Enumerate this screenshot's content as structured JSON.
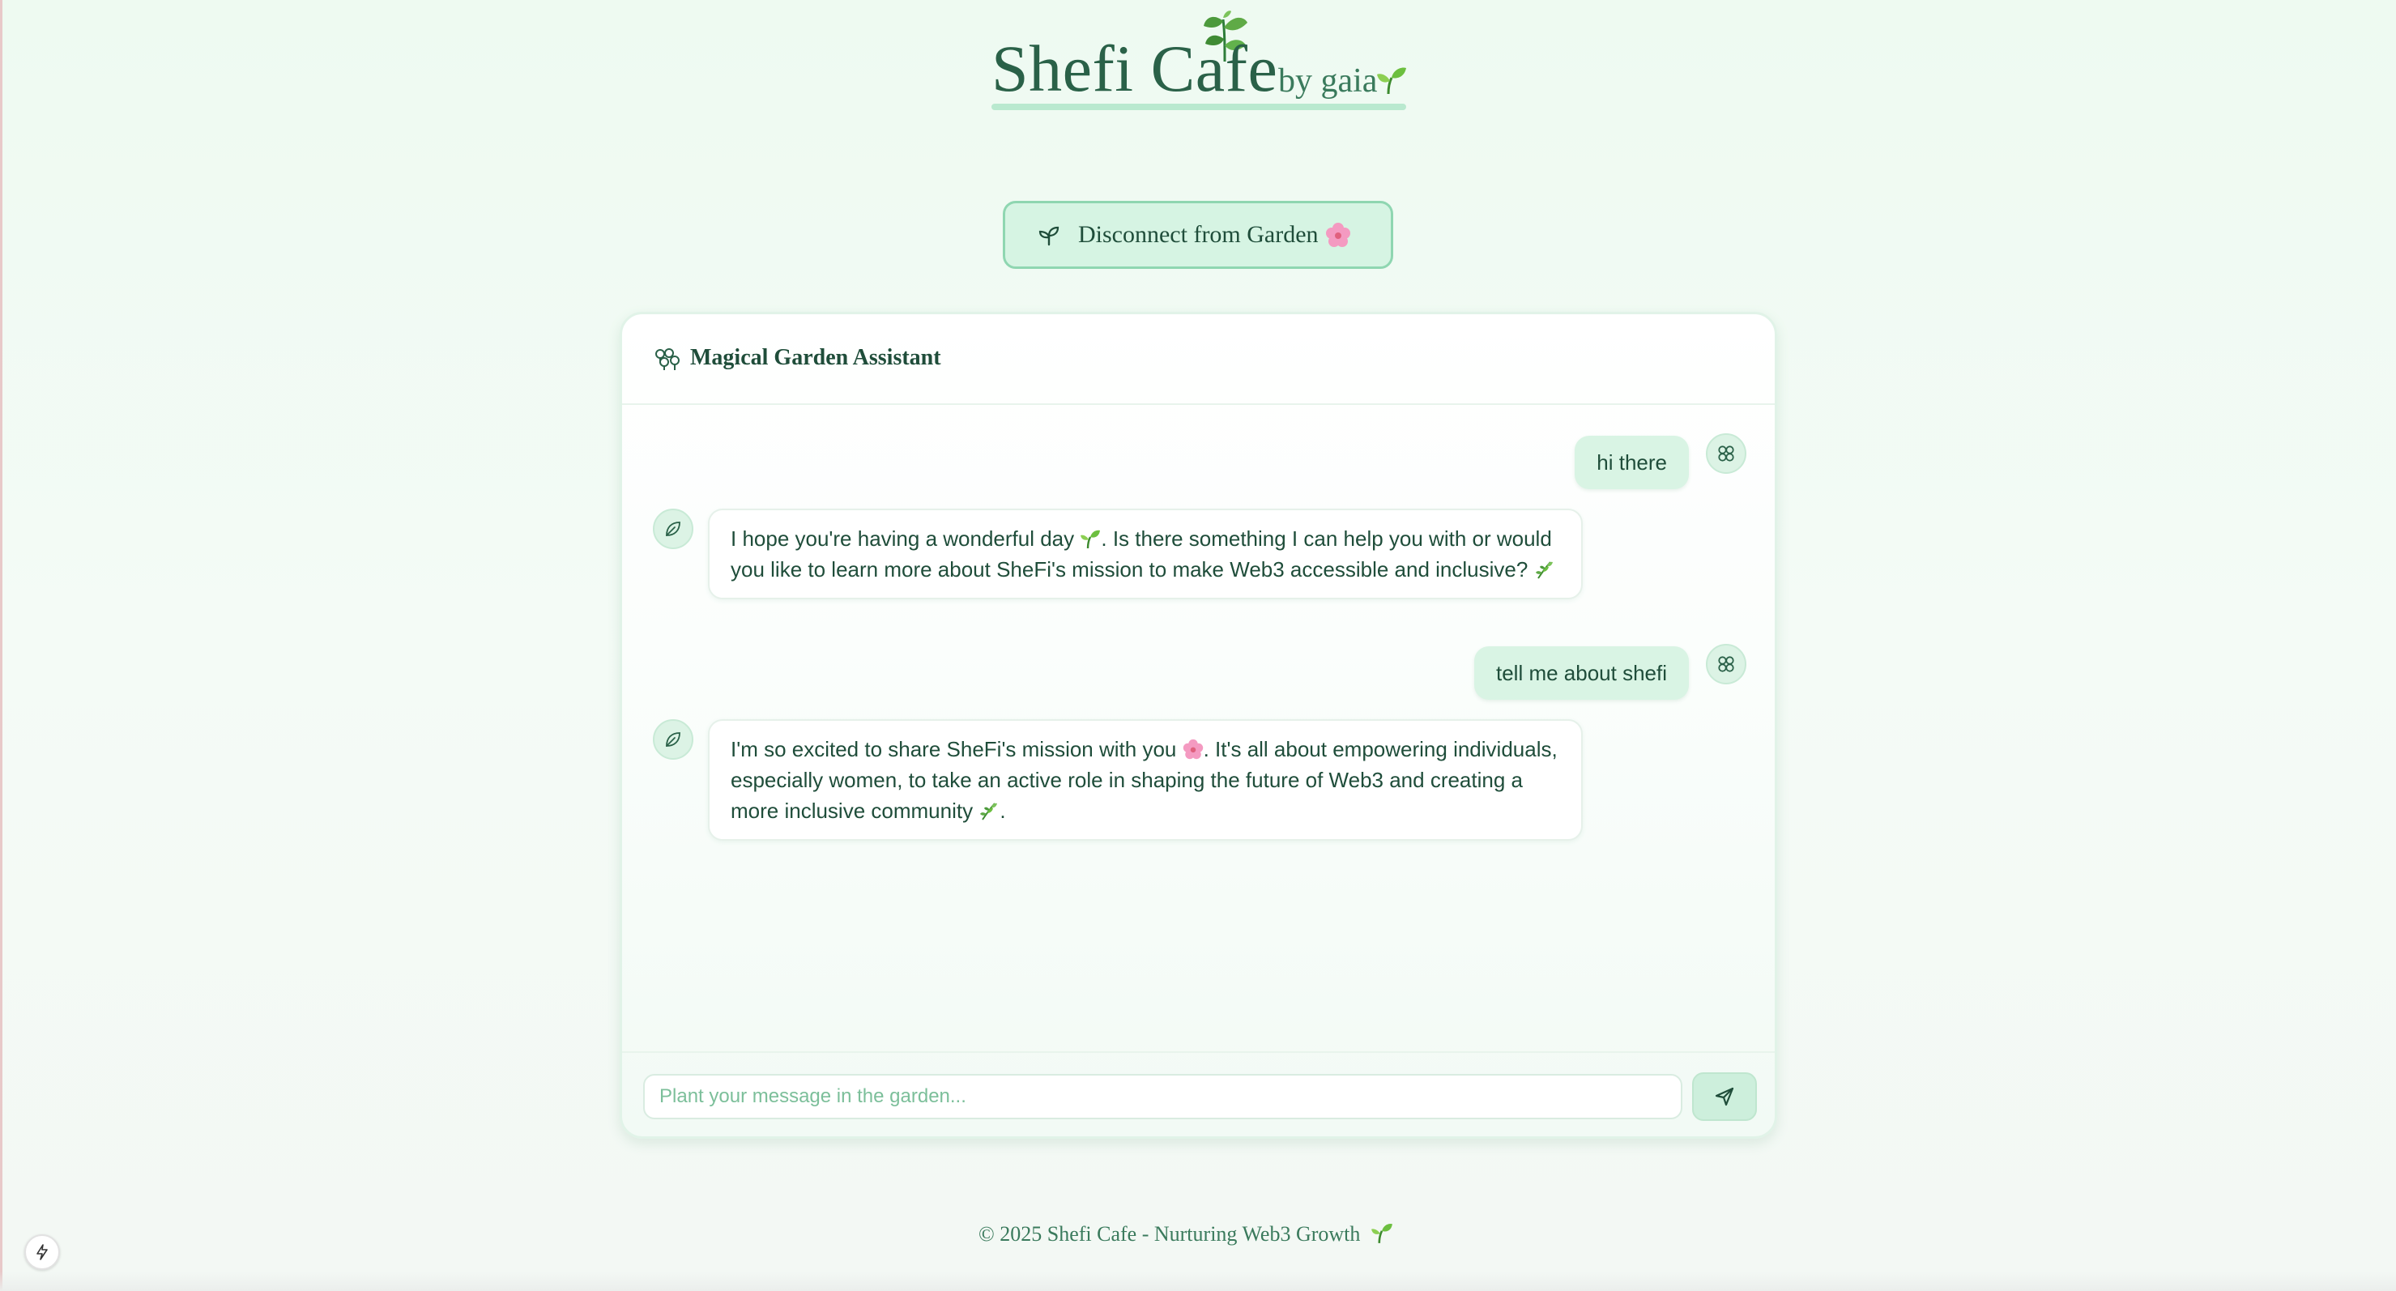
{
  "header": {
    "title": "Shefi Cafe",
    "byline": "by gaia"
  },
  "disconnect_button": {
    "label": "Disconnect from Garden"
  },
  "chat": {
    "title": "Magical Garden Assistant",
    "messages": [
      {
        "role": "user",
        "text": "hi there"
      },
      {
        "role": "assistant",
        "text_1": "I hope you're having a wonderful day",
        "text_2": ". Is there something I can help you with or would you like to learn more about SheFi's mission to make Web3 accessible and inclusive?"
      },
      {
        "role": "user",
        "text": "tell me about shefi"
      },
      {
        "role": "assistant",
        "text_1": "I'm so excited to share SheFi's mission with you",
        "text_2": ". It's all about empowering individuals, especially women, to take an active role in shaping the future of Web3 and creating a more inclusive community",
        "text_3": "."
      }
    ],
    "input": {
      "placeholder": "Plant your message in the garden...",
      "value": ""
    }
  },
  "footer": {
    "text": "© 2025 Shefi Cafe - Nurturing Web3 Growth"
  },
  "icons": {
    "title_decoration": "leaves-icon",
    "byline_decoration": "sprout-icon",
    "disconnect_icon": "sprout-icon",
    "disconnect_emoji": "cherry-blossom-icon",
    "chat_header_icon": "flowers-icon",
    "user_avatar": "clover-icon",
    "assistant_avatar": "leaf-icon",
    "send": "send-icon",
    "dev_tools": "lightning-icon"
  },
  "colors": {
    "brand_green": "#2a6148",
    "accent_mint": "#d6f4e3",
    "border_mint": "#8fd6b1",
    "text_dark": "#1f4d3a",
    "placeholder": "#7cbf9a"
  }
}
